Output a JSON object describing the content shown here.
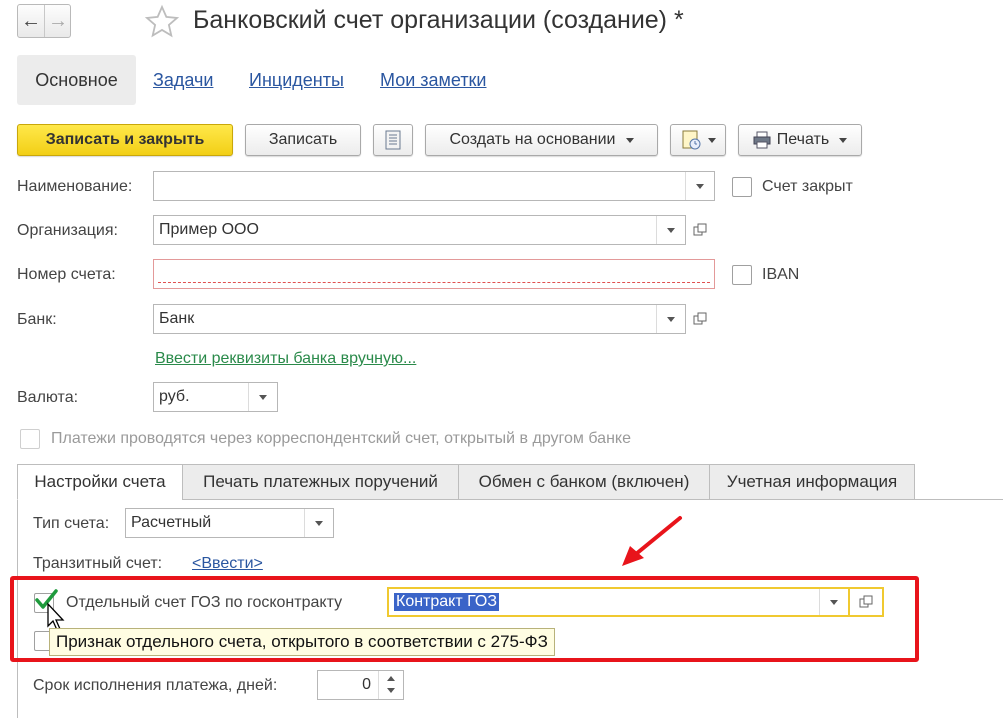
{
  "header": {
    "title": "Банковский счет организации (создание) *"
  },
  "section_tabs": [
    "Основное",
    "Задачи",
    "Инциденты",
    "Мои заметки"
  ],
  "toolbar": {
    "save_close": "Записать и закрыть",
    "save": "Записать",
    "create_based": "Создать на основании",
    "print": "Печать"
  },
  "form": {
    "name_label": "Наименование:",
    "name_value": "",
    "account_closed_label": "Счет закрыт",
    "org_label": "Организация:",
    "org_value": "Пример ООО",
    "acc_number_label": "Номер счета:",
    "acc_number_value": "",
    "iban_label": "IBAN",
    "bank_label": "Банк:",
    "bank_value": "Банк",
    "bank_manual_link": "Ввести реквизиты банка вручную...",
    "currency_label": "Валюта:",
    "currency_value": "руб.",
    "corr_account_label": "Платежи проводятся через корреспондентский счет, открытый в другом банке"
  },
  "tabs": [
    "Настройки счета",
    "Печать платежных поручений",
    "Обмен с банком (включен)",
    "Учетная информация"
  ],
  "settings": {
    "acc_type_label": "Тип счета:",
    "acc_type_value": "Расчетный",
    "transit_label": "Транзитный счет:",
    "transit_link": "<Ввести>",
    "goz_label": "Отдельный счет ГОЗ по госконтракту",
    "goz_checked": true,
    "goz_contract_value": "Контракт ГОЗ",
    "tooltip": "Признак отдельного счета, открытого в соответствии с 275-ФЗ",
    "payment_term_label": "Срок исполнения платежа, дней:",
    "payment_term_value": "0"
  },
  "colors": {
    "primary_button": "#f5d31c",
    "highlight_box": "#e8141b",
    "arrow": "#e8141b",
    "selection": "#3a64c8",
    "field_focus": "#f0c930"
  }
}
